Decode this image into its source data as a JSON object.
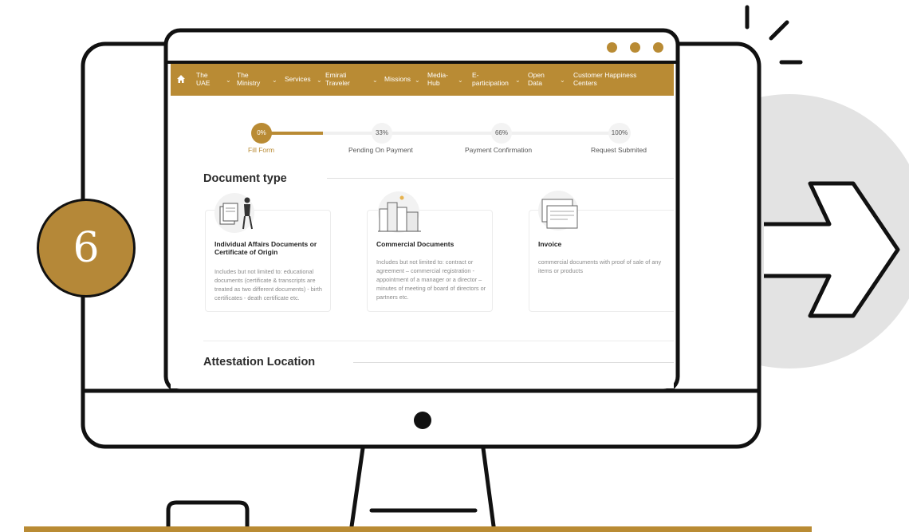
{
  "badge": {
    "number": "6"
  },
  "colors": {
    "gold": "#b98b34",
    "outline": "#111111",
    "grey_circle": "#e3e3e3"
  },
  "nav": {
    "home_icon": "home-icon",
    "items": [
      {
        "label": "The\nUAE",
        "has_dropdown": true
      },
      {
        "label": "The\nMinistry",
        "has_dropdown": true
      },
      {
        "label": "Services",
        "has_dropdown": true
      },
      {
        "label": "Emirati\nTraveler",
        "has_dropdown": true
      },
      {
        "label": "Missions",
        "has_dropdown": true
      },
      {
        "label": "Media-\nHub",
        "has_dropdown": true
      },
      {
        "label": "E-\nparticipation",
        "has_dropdown": true
      },
      {
        "label": "Open\nData",
        "has_dropdown": true
      },
      {
        "label": "Customer Happiness\nCenters",
        "has_dropdown": false
      }
    ]
  },
  "progress": {
    "steps": [
      {
        "percent": "0%",
        "label": "Fill Form",
        "active": true
      },
      {
        "percent": "33%",
        "label": "Pending On Payment",
        "active": false
      },
      {
        "percent": "66%",
        "label": "Payment Confirmation",
        "active": false
      },
      {
        "percent": "100%",
        "label": "Request Submited",
        "active": false
      }
    ]
  },
  "document_type": {
    "title": "Document type",
    "cards": [
      {
        "title": "Individual Affairs Documents or Certificate of Origin",
        "description": "Includes but not limited to: educational documents (certificate & transcripts are treated as two different documents) - birth certificates - death certificate etc."
      },
      {
        "title": "Commercial Documents",
        "description": "Includes but not limited to: contract or agreement – commercial registration - appointment of a manager or a director – minutes of meeting of board of directors or partners etc."
      },
      {
        "title": "Invoice",
        "description": "commercial documents with proof of sale of any items or products"
      }
    ]
  },
  "attestation_location": {
    "title": "Attestation Location"
  }
}
